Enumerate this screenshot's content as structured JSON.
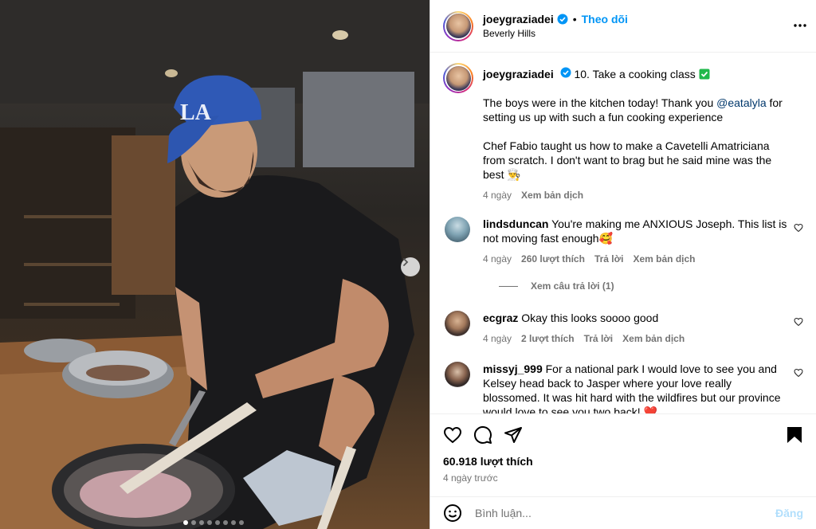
{
  "post": {
    "username": "joeygraziadei",
    "follow_label": "Theo dõi",
    "location": "Beverly Hills",
    "separator": "•",
    "carousel": {
      "slides": 8,
      "active_index": 0
    }
  },
  "caption": {
    "username": "joeygraziadei",
    "title": "10. Take a cooking class",
    "text_before_mention": "The boys were in the kitchen today! Thank you ",
    "mention": "@eatalyla",
    "text_after_mention": " for setting us up with such a fun cooking experience",
    "paragraph2": "Chef Fabio taught us how to make a Cavetelli Amatriciana from scratch. I don't want to brag but he said mine was the best 👨‍🍳",
    "time": "4 ngày",
    "translate": "Xem bản dịch"
  },
  "comments": [
    {
      "username": "lindsduncan",
      "text": "You're making me ANXIOUS Joseph. This list is not moving fast enough🥰",
      "time": "4 ngày",
      "likes": "260 lượt thích",
      "reply": "Trả lời",
      "translate": "Xem bản dịch",
      "view_replies": "Xem câu trả lời (1)"
    },
    {
      "username": "ecgraz",
      "text": "Okay this looks soooo good",
      "time": "4 ngày",
      "likes": "2 lượt thích",
      "reply": "Trả lời",
      "translate": "Xem bản dịch"
    },
    {
      "username": "missyj_999",
      "text": "For a national park I would love to see you and Kelsey head back to Jasper where your love really blossomed. It was hit hard with the wildfires but our province would love to see you two back! ❤️"
    }
  ],
  "footer": {
    "likes_count": "60.918 lượt thích",
    "time_ago": "4 ngày trước",
    "comment_placeholder": "Bình luận...",
    "post_label": "Đăng"
  },
  "colors": {
    "accent": "#0095f6",
    "mention": "#00376b",
    "muted": "#737373",
    "post_disabled": "#b2dffc"
  }
}
